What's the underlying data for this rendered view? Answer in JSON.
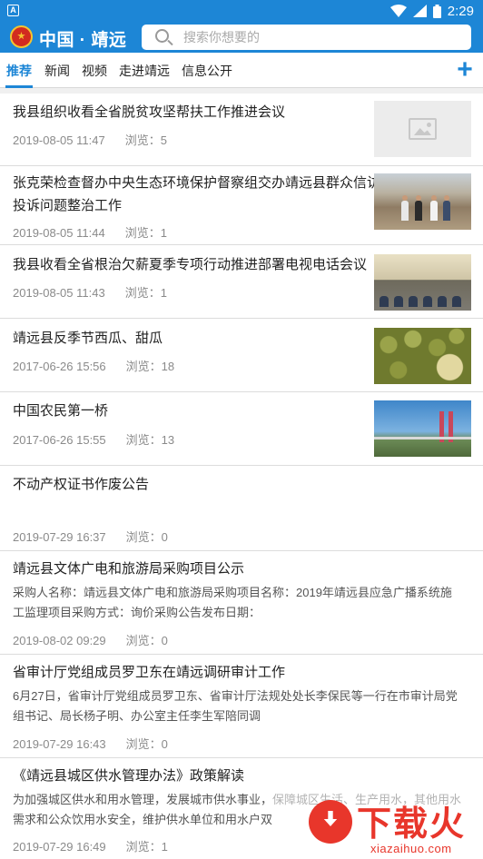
{
  "status_bar": {
    "app_icon_label": "A",
    "time": "2:29"
  },
  "header": {
    "title": "中国 · 靖远",
    "search_placeholder": "搜索你想要的"
  },
  "tabs": [
    {
      "label": "推荐",
      "active": true
    },
    {
      "label": "新闻"
    },
    {
      "label": "视频"
    },
    {
      "label": "走进靖远"
    },
    {
      "label": "信息公开"
    }
  ],
  "news": [
    {
      "title": "我县组织收看全省脱贫攻坚帮扶工作推进会议",
      "date": "2019-08-05 11:47",
      "views": "浏览：5",
      "image": "placeholder-icon"
    },
    {
      "title_line1": "张克荣检查督办中央生态环境保护督察组交办靖远县群众信访",
      "title_line2": "投诉问题整治工作",
      "date": "2019-08-05 11:44",
      "views": "浏览：1",
      "image": "inspection-photo"
    },
    {
      "title": "我县收看全省根治欠薪夏季专项行动推进部署电视电话会议",
      "date": "2019-08-05 11:43",
      "views": "浏览：1",
      "image": "meeting-photo"
    },
    {
      "title": "靖远县反季节西瓜、甜瓜",
      "date": "2017-06-26 15:56",
      "views": "浏览：18",
      "image": "melon-photo"
    },
    {
      "title": "中国农民第一桥",
      "date": "2017-06-26 15:55",
      "views": "浏览：13",
      "image": "bridge-photo"
    },
    {
      "title": "不动产权证书作废公告",
      "date": "2019-07-29 16:37",
      "views": "浏览：0"
    },
    {
      "title": "靖远县文体广电和旅游局采购项目公示",
      "summary_line1": "采购人名称：靖远县文体广电和旅游局采购项目名称：2019年靖远县应急广播系统施",
      "summary_line2": "工监理项目采购方式：询价采购公告发布日期：",
      "date": "2019-08-02 09:29",
      "views": "浏览：0"
    },
    {
      "title": "省审计厅党组成员罗卫东在靖远调研审计工作",
      "summary_line1": "6月27日，省审计厅党组成员罗卫东、省审计厅法规处处长李保民等一行在市审计局党",
      "summary_line2": "组书记、局长杨子明、办公室主任李生军陪同调",
      "date": "2019-07-29 16:43",
      "views": "浏览：0"
    },
    {
      "title": "《靖远县城区供水管理办法》政策解读",
      "summary_line1": "为加强城区供水和用水管理，发展城市供水事业，保障城区生活、生产用水，其他用水",
      "summary_line2": "需求和公众饮用水安全，维护供水单位和用水户双",
      "date": "2019-07-29 16:49",
      "views": "浏览：1"
    }
  ],
  "watermark": {
    "text": "下载火",
    "url": "xiazaihuo.com"
  },
  "colors": {
    "brand": "#1d86d6",
    "watermark": "#e8362b"
  }
}
